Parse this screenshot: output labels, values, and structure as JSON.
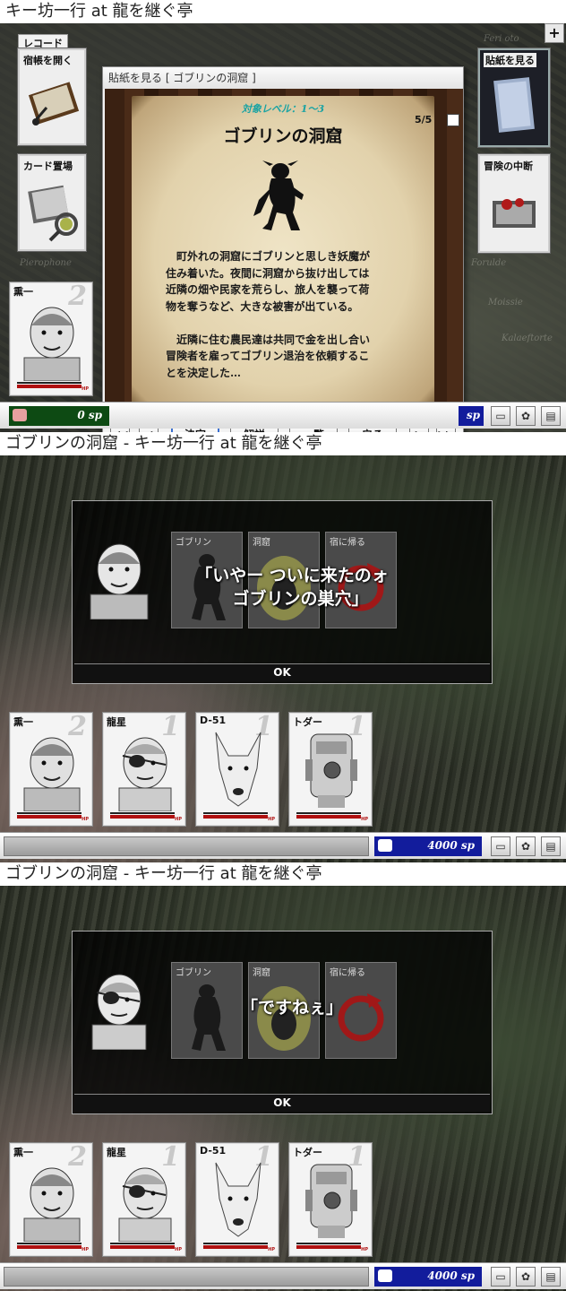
{
  "panel1": {
    "title": "キー坊一行 at 龍を継ぐ亭",
    "menu_group_label": "レコード",
    "menu": [
      {
        "label": "宿帳を開く"
      },
      {
        "label": "カード置場"
      },
      {
        "label": "貼紙を見る"
      },
      {
        "label": "冒険の中断"
      }
    ],
    "map_words": [
      "Feri oto",
      "Pierophone",
      "Forulde",
      "Moissie",
      "Kalaeftorte"
    ],
    "dialog": {
      "title": "貼紙を見る [ ゴブリンの洞窟 ]",
      "page": "5/5",
      "level": "対象レベル：1〜3",
      "quest_title": "ゴブリンの洞窟",
      "body": "　町外れの洞窟にゴブリンと思しき妖魔が\n住み着いた。夜間に洞窟から抜け出しては\n近隣の畑や民家を荒らし、旅人を襲って荷\n物を奪うなど、大きな被害が出ている。\n\n　近隣に住む農民達は共同で金を出し合い\n冒険者を雇ってゴブリン退治を依頼するこ\nとを決定した…",
      "buttons": {
        "decide": "決定",
        "explain": "解説",
        "list": "一覧",
        "back": "戻る"
      }
    },
    "party": [
      {
        "name": "熏一",
        "level": "2"
      }
    ],
    "money": "0 sp",
    "money_partial": "sp"
  },
  "panel2": {
    "title": "ゴブリンの洞窟 - キー坊一行 at 龍を継ぐ亭",
    "speech": "「いやー ついに来たのォ\n　ゴブリンの巣穴」",
    "ok": "OK",
    "options": [
      {
        "label": "ゴブリン"
      },
      {
        "label": "洞窟"
      },
      {
        "label": "宿に帰る"
      }
    ],
    "party": [
      {
        "name": "熏一",
        "level": "2"
      },
      {
        "name": "龍星",
        "level": "1"
      },
      {
        "name": "D-51",
        "level": "1"
      },
      {
        "name": "トダー",
        "level": "1"
      }
    ],
    "money": "4000 sp"
  },
  "panel3": {
    "title": "ゴブリンの洞窟 - キー坊一行 at 龍を継ぐ亭",
    "speech": "「ですねぇ」",
    "ok": "OK",
    "options": [
      {
        "label": "ゴブリン"
      },
      {
        "label": "洞窟"
      },
      {
        "label": "宿に帰る"
      }
    ],
    "party": [
      {
        "name": "熏一",
        "level": "2"
      },
      {
        "name": "龍星",
        "level": "1"
      },
      {
        "name": "D-51",
        "level": "1"
      },
      {
        "name": "トダー",
        "level": "1"
      }
    ],
    "money": "4000 sp"
  },
  "hp_label": "HP",
  "colors": {
    "money_bg": "#121c9c",
    "hp_bar": "#b01010",
    "ok_text": "#ffffff"
  },
  "icons": [
    "plus-icon",
    "list-icon",
    "first-icon",
    "prev-icon",
    "next-icon",
    "last-icon",
    "pig-icon",
    "coins-icon",
    "speech-icon",
    "gear-icon",
    "card-icon"
  ]
}
